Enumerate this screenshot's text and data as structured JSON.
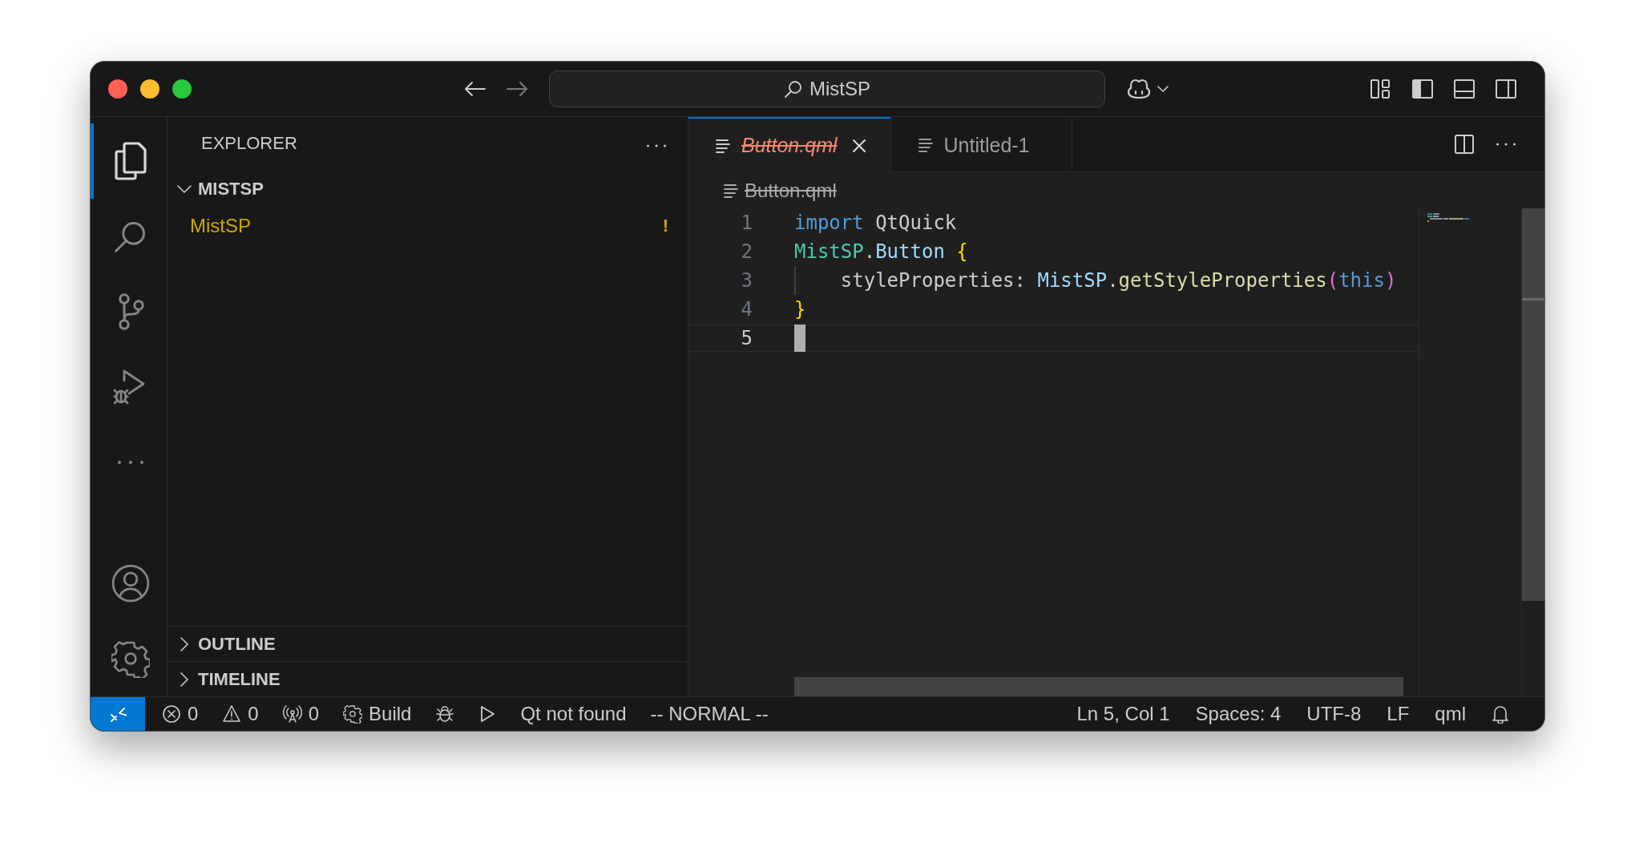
{
  "window": {
    "search": "MistSP"
  },
  "activity_bar": {
    "items": [
      {
        "kind": "files",
        "selected": true
      },
      {
        "kind": "search",
        "selected": false
      },
      {
        "kind": "source-control",
        "selected": false
      },
      {
        "kind": "run-debug",
        "selected": false
      },
      {
        "kind": "more",
        "selected": false
      }
    ],
    "bottom": [
      {
        "kind": "account"
      },
      {
        "kind": "settings"
      }
    ]
  },
  "sidebar": {
    "title": "EXPLORER",
    "folder": {
      "label": "MISTSP",
      "expanded": true,
      "items": [
        {
          "label": "MistSP",
          "badge": "!",
          "warning": true
        }
      ]
    },
    "sections": [
      {
        "label": "OUTLINE",
        "expanded": false
      },
      {
        "label": "TIMELINE",
        "expanded": false
      }
    ]
  },
  "tabs": [
    {
      "label": "Button.qml",
      "selected": true,
      "deleted": true
    },
    {
      "label": "Untitled-1",
      "selected": false,
      "deleted": false
    }
  ],
  "breadcrumb": {
    "label": "Button.qml",
    "deleted": true
  },
  "editor": {
    "lines": [
      {
        "number": "1",
        "current": false,
        "guide": false,
        "tokens": [
          {
            "kind": "keyword",
            "text": "import"
          },
          {
            "kind": "plain",
            "text": " QtQuick"
          }
        ]
      },
      {
        "number": "2",
        "current": false,
        "guide": false,
        "tokens": [
          {
            "kind": "type",
            "text": "MistSP"
          },
          {
            "kind": "plain",
            "text": "."
          },
          {
            "kind": "property",
            "text": "Button"
          },
          {
            "kind": "brace",
            "text": " {"
          }
        ]
      },
      {
        "number": "3",
        "current": false,
        "guide": true,
        "tokens": [
          {
            "kind": "plain",
            "text": "    styleProperties: "
          },
          {
            "kind": "property",
            "text": "MistSP"
          },
          {
            "kind": "plain",
            "text": "."
          },
          {
            "kind": "function",
            "text": "getStyleProperties"
          },
          {
            "kind": "paren",
            "text": "("
          },
          {
            "kind": "keyword",
            "text": "this"
          },
          {
            "kind": "paren",
            "text": ")"
          }
        ]
      },
      {
        "number": "4",
        "current": false,
        "guide": false,
        "tokens": [
          {
            "kind": "brace",
            "text": "}"
          }
        ]
      },
      {
        "number": "5",
        "current": true,
        "guide": false
      }
    ]
  },
  "status_bar": {
    "left": [
      {
        "kind": "remote"
      },
      {
        "kind": "errors",
        "text": "0"
      },
      {
        "kind": "warnings",
        "text": "0"
      },
      {
        "kind": "ports",
        "text": "0"
      },
      {
        "kind": "build",
        "text": "Build"
      },
      {
        "kind": "debug"
      },
      {
        "kind": "run"
      },
      {
        "kind": "text",
        "text": "Qt not found"
      },
      {
        "kind": "text",
        "text": "-- NORMAL --"
      }
    ],
    "right": [
      {
        "kind": "text",
        "text": "Ln 5, Col 1"
      },
      {
        "kind": "text",
        "text": "Spaces: 4"
      },
      {
        "kind": "text",
        "text": "UTF-8"
      },
      {
        "kind": "text",
        "text": "LF"
      },
      {
        "kind": "text",
        "text": "qml"
      },
      {
        "kind": "bell"
      }
    ]
  }
}
